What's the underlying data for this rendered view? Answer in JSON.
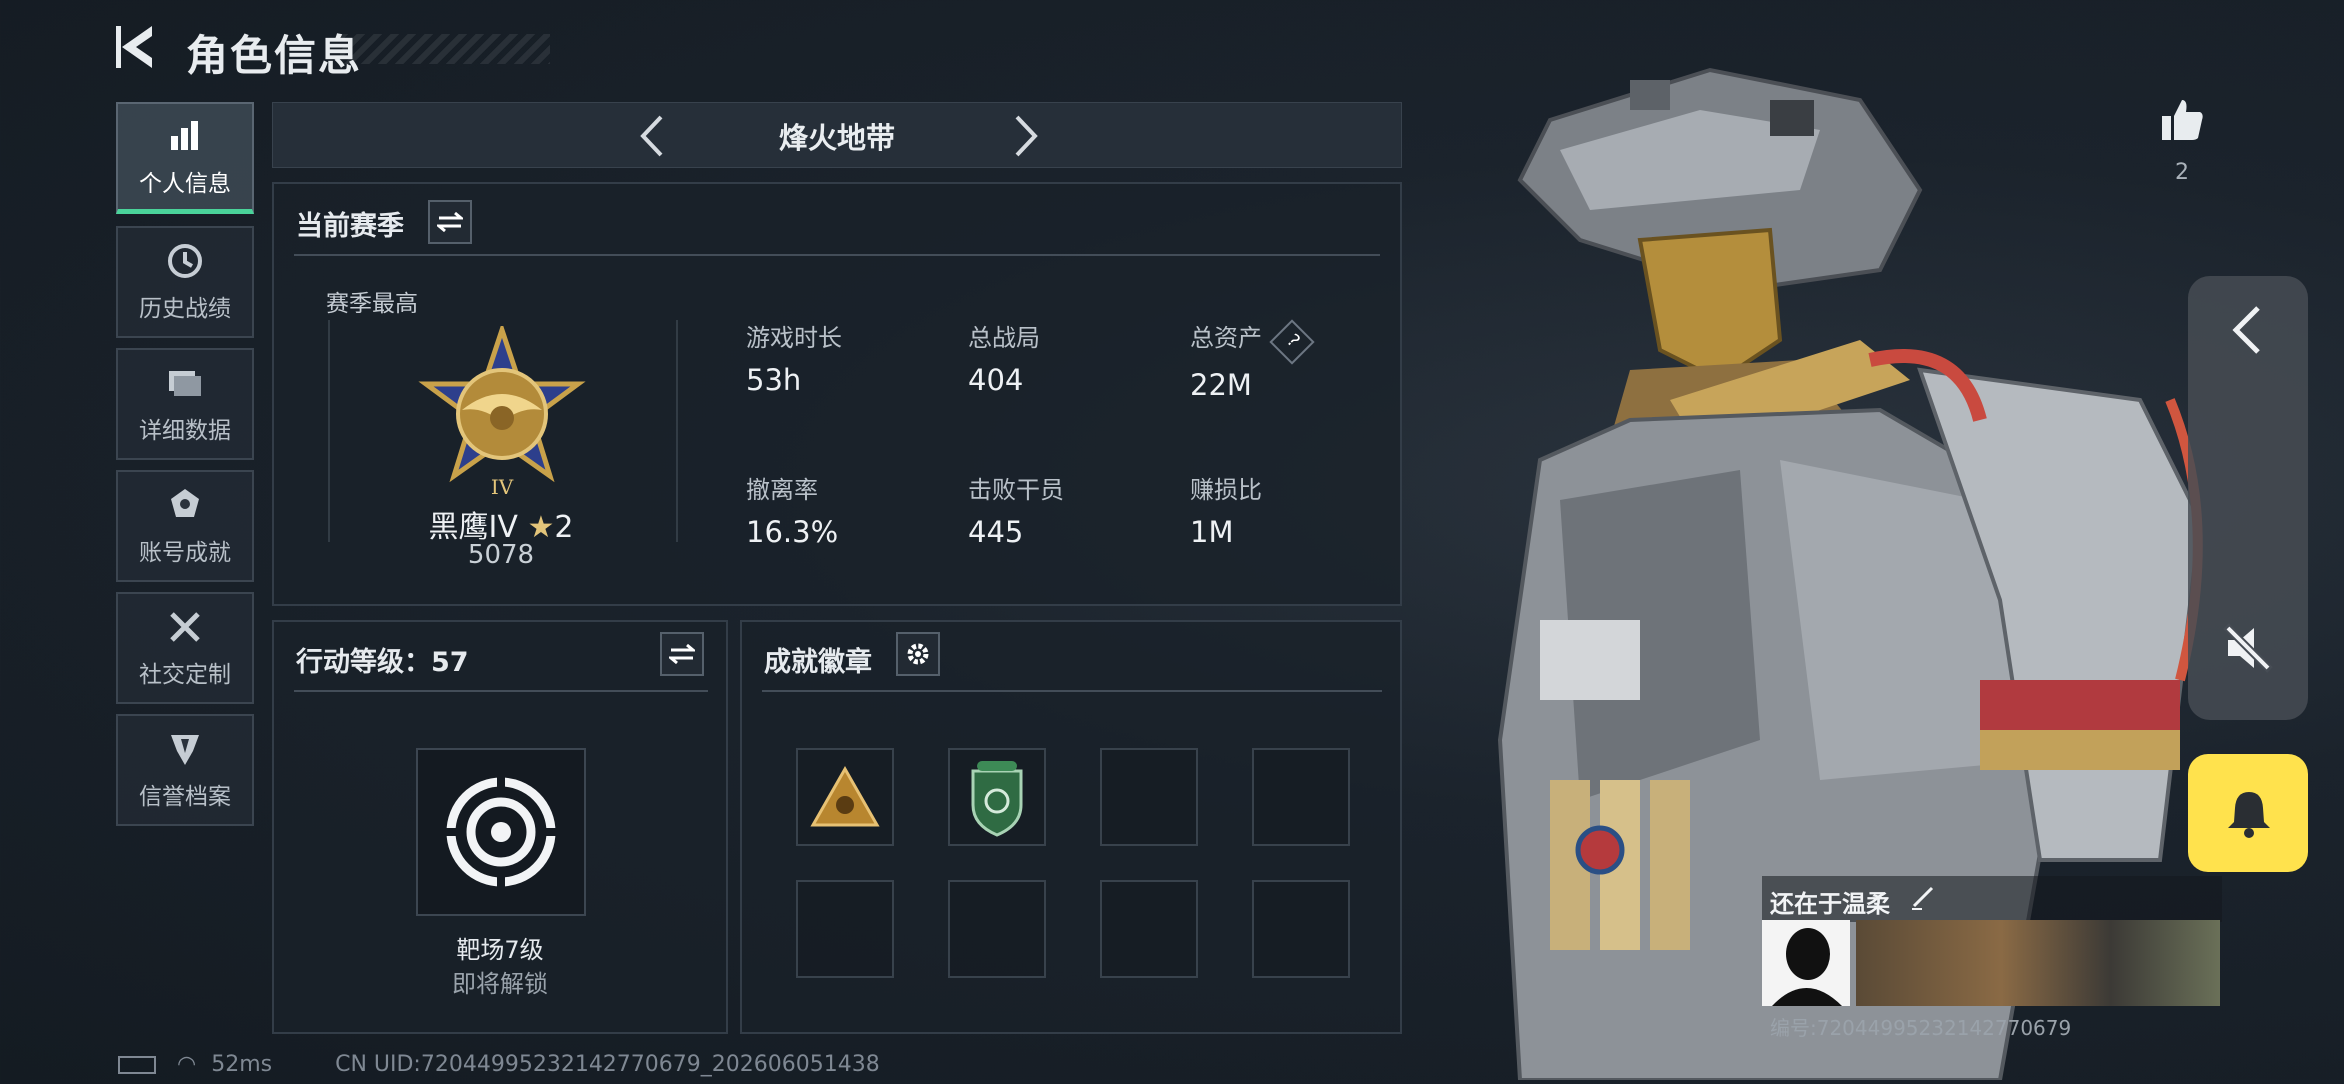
{
  "header": {
    "title": "角色信息"
  },
  "sidebar": {
    "items": [
      {
        "label": "个人信息",
        "icon": "bar-chart-icon",
        "active": true
      },
      {
        "label": "历史战绩",
        "icon": "clock-icon"
      },
      {
        "label": "详细数据",
        "icon": "folder-icon"
      },
      {
        "label": "账号成就",
        "icon": "medal-icon"
      },
      {
        "label": "社交定制",
        "icon": "tools-icon"
      },
      {
        "label": "信誉档案",
        "icon": "shield-icon"
      }
    ]
  },
  "mode": {
    "name": "烽火地带"
  },
  "season": {
    "title": "当前赛季",
    "best_label": "赛季最高",
    "rank_name": "黑鹰IV",
    "rank_stars": "2",
    "rank_points": "5078",
    "stats": [
      {
        "label": "游戏时长",
        "value": "53h"
      },
      {
        "label": "总战局",
        "value": "404"
      },
      {
        "label": "总资产",
        "value": "22M",
        "help": "?"
      },
      {
        "label": "撤离率",
        "value": "16.3%"
      },
      {
        "label": "击败干员",
        "value": "445"
      },
      {
        "label": "赚损比",
        "value": "1M"
      }
    ]
  },
  "action_level": {
    "title": "行动等级：57",
    "item_name": "靶场7级",
    "item_status": "即将解锁"
  },
  "achievements": {
    "title": "成就徽章"
  },
  "likes": {
    "count": "2"
  },
  "profile_card": {
    "name": "还在于温柔",
    "id_text": "编号:72044995232142770679"
  },
  "status": {
    "ping": "52ms",
    "uid": "CN UID:72044995232142770679_202606051438"
  },
  "colors": {
    "accent_green": "#4ad39a",
    "bell_yellow": "#ffe24d",
    "gold": "#c9a24a"
  }
}
